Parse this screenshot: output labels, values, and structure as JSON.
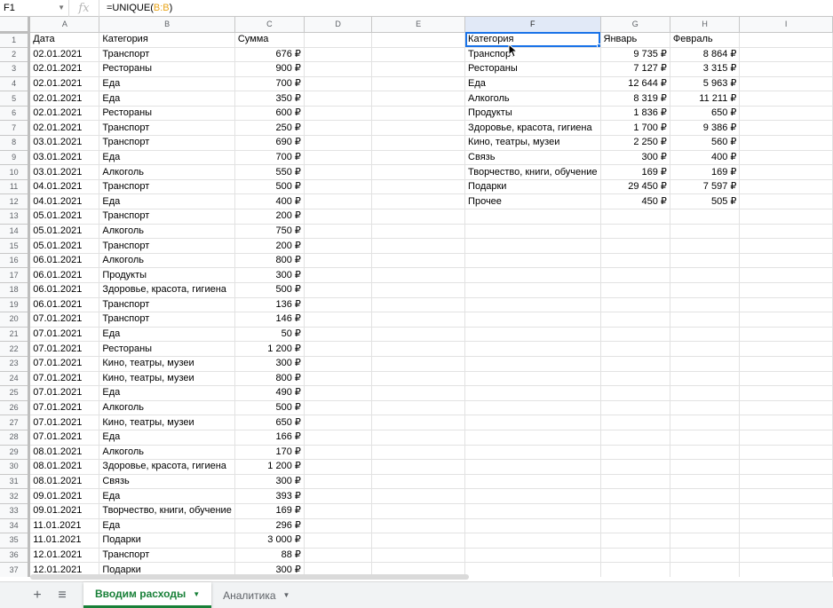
{
  "name_box": "F1",
  "formula": {
    "prefix": "=UNIQUE(",
    "ref": "B:B",
    "suffix": ")"
  },
  "columns": [
    "A",
    "B",
    "C",
    "D",
    "E",
    "F",
    "G",
    "H",
    "I"
  ],
  "rows": [
    [
      "Дата",
      "Категория",
      "Сумма",
      "",
      "",
      "Категория",
      "Январь",
      "Февраль",
      ""
    ],
    [
      "02.01.2021",
      "Транспорт",
      "676 ₽",
      "",
      "",
      "Транспорт",
      "9 735 ₽",
      "8 864 ₽",
      ""
    ],
    [
      "02.01.2021",
      "Рестораны",
      "900 ₽",
      "",
      "",
      "Рестораны",
      "7 127 ₽",
      "3 315 ₽",
      ""
    ],
    [
      "02.01.2021",
      "Еда",
      "700 ₽",
      "",
      "",
      "Еда",
      "12 644 ₽",
      "5 963 ₽",
      ""
    ],
    [
      "02.01.2021",
      "Еда",
      "350 ₽",
      "",
      "",
      "Алкоголь",
      "8 319 ₽",
      "11 211 ₽",
      ""
    ],
    [
      "02.01.2021",
      "Рестораны",
      "600 ₽",
      "",
      "",
      "Продукты",
      "1 836 ₽",
      "650 ₽",
      ""
    ],
    [
      "02.01.2021",
      "Транспорт",
      "250 ₽",
      "",
      "",
      "Здоровье, красота, гигиена",
      "1 700 ₽",
      "9 386 ₽",
      ""
    ],
    [
      "03.01.2021",
      "Транспорт",
      "690 ₽",
      "",
      "",
      "Кино, театры, музеи",
      "2 250 ₽",
      "560 ₽",
      ""
    ],
    [
      "03.01.2021",
      "Еда",
      "700 ₽",
      "",
      "",
      "Связь",
      "300 ₽",
      "400 ₽",
      ""
    ],
    [
      "03.01.2021",
      "Алкоголь",
      "550 ₽",
      "",
      "",
      "Творчество, книги, обучение",
      "169 ₽",
      "169 ₽",
      ""
    ],
    [
      "04.01.2021",
      "Транспорт",
      "500 ₽",
      "",
      "",
      "Подарки",
      "29 450 ₽",
      "7 597 ₽",
      ""
    ],
    [
      "04.01.2021",
      "Еда",
      "400 ₽",
      "",
      "",
      "Прочее",
      "450 ₽",
      "505 ₽",
      ""
    ],
    [
      "05.01.2021",
      "Транспорт",
      "200 ₽",
      "",
      "",
      "",
      "",
      "",
      ""
    ],
    [
      "05.01.2021",
      "Алкоголь",
      "750 ₽",
      "",
      "",
      "",
      "",
      "",
      ""
    ],
    [
      "05.01.2021",
      "Транспорт",
      "200 ₽",
      "",
      "",
      "",
      "",
      "",
      ""
    ],
    [
      "06.01.2021",
      "Алкоголь",
      "800 ₽",
      "",
      "",
      "",
      "",
      "",
      ""
    ],
    [
      "06.01.2021",
      "Продукты",
      "300 ₽",
      "",
      "",
      "",
      "",
      "",
      ""
    ],
    [
      "06.01.2021",
      "Здоровье, красота, гигиена",
      "500 ₽",
      "",
      "",
      "",
      "",
      "",
      ""
    ],
    [
      "06.01.2021",
      "Транспорт",
      "136 ₽",
      "",
      "",
      "",
      "",
      "",
      ""
    ],
    [
      "07.01.2021",
      "Транспорт",
      "146 ₽",
      "",
      "",
      "",
      "",
      "",
      ""
    ],
    [
      "07.01.2021",
      "Еда",
      "50 ₽",
      "",
      "",
      "",
      "",
      "",
      ""
    ],
    [
      "07.01.2021",
      "Рестораны",
      "1 200 ₽",
      "",
      "",
      "",
      "",
      "",
      ""
    ],
    [
      "07.01.2021",
      "Кино, театры, музеи",
      "300 ₽",
      "",
      "",
      "",
      "",
      "",
      ""
    ],
    [
      "07.01.2021",
      "Кино, театры, музеи",
      "800 ₽",
      "",
      "",
      "",
      "",
      "",
      ""
    ],
    [
      "07.01.2021",
      "Еда",
      "490 ₽",
      "",
      "",
      "",
      "",
      "",
      ""
    ],
    [
      "07.01.2021",
      "Алкоголь",
      "500 ₽",
      "",
      "",
      "",
      "",
      "",
      ""
    ],
    [
      "07.01.2021",
      "Кино, театры, музеи",
      "650 ₽",
      "",
      "",
      "",
      "",
      "",
      ""
    ],
    [
      "07.01.2021",
      "Еда",
      "166 ₽",
      "",
      "",
      "",
      "",
      "",
      ""
    ],
    [
      "08.01.2021",
      "Алкоголь",
      "170 ₽",
      "",
      "",
      "",
      "",
      "",
      ""
    ],
    [
      "08.01.2021",
      "Здоровье, красота, гигиена",
      "1 200 ₽",
      "",
      "",
      "",
      "",
      "",
      ""
    ],
    [
      "08.01.2021",
      "Связь",
      "300 ₽",
      "",
      "",
      "",
      "",
      "",
      ""
    ],
    [
      "09.01.2021",
      "Еда",
      "393 ₽",
      "",
      "",
      "",
      "",
      "",
      ""
    ],
    [
      "09.01.2021",
      "Творчество, книги, обучение",
      "169 ₽",
      "",
      "",
      "",
      "",
      "",
      ""
    ],
    [
      "11.01.2021",
      "Еда",
      "296 ₽",
      "",
      "",
      "",
      "",
      "",
      ""
    ],
    [
      "11.01.2021",
      "Подарки",
      "3 000 ₽",
      "",
      "",
      "",
      "",
      "",
      ""
    ],
    [
      "12.01.2021",
      "Транспорт",
      "88 ₽",
      "",
      "",
      "",
      "",
      "",
      ""
    ],
    [
      "12.01.2021",
      "Подарки",
      "300 ₽",
      "",
      "",
      "",
      "",
      "",
      ""
    ]
  ],
  "tabs": {
    "add_icon": "+",
    "list_icon": "≡",
    "sheets": [
      {
        "label": "Вводим расходы",
        "active": true
      },
      {
        "label": "Аналитика",
        "active": false
      }
    ],
    "arrow": "▼"
  },
  "colors": {
    "selection": "#1a73e8",
    "active_tab": "#188038"
  }
}
